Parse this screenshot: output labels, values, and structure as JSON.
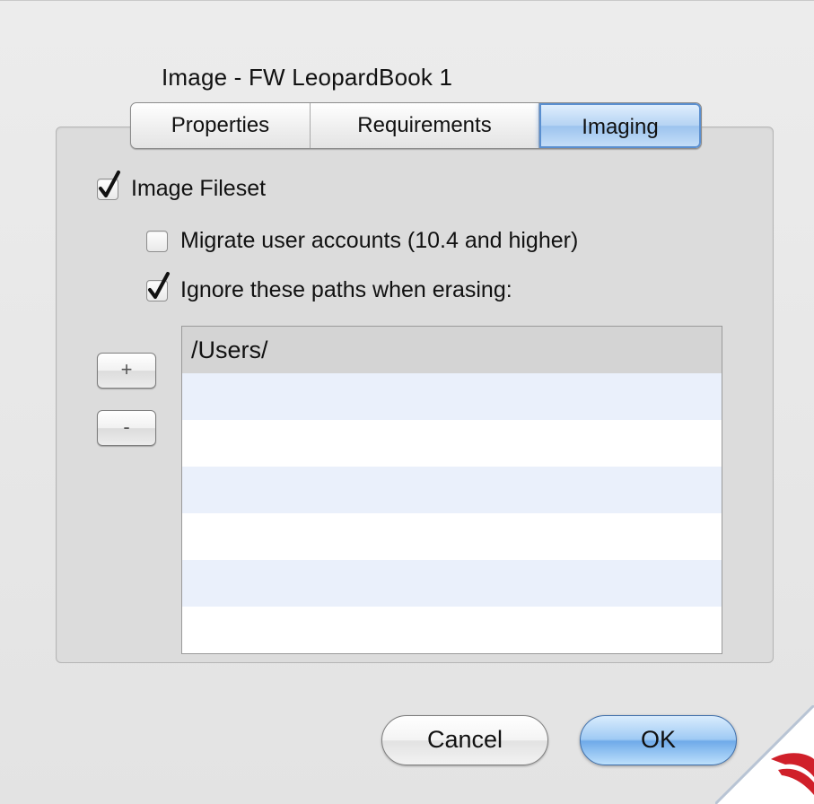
{
  "dialog": {
    "title": "Image - FW LeopardBook 1"
  },
  "tabs": [
    {
      "label": "Properties",
      "active": false
    },
    {
      "label": "Requirements",
      "active": false
    },
    {
      "label": "Imaging",
      "active": true
    }
  ],
  "imaging": {
    "image_fileset": {
      "label": "Image Fileset",
      "checked": true
    },
    "migrate_accounts": {
      "label": "Migrate user accounts (10.4 and higher)",
      "checked": false
    },
    "ignore_paths": {
      "label": "Ignore these paths when erasing:",
      "checked": true
    },
    "add_label": "+",
    "remove_label": "-",
    "paths": [
      "/Users/"
    ]
  },
  "buttons": {
    "cancel": "Cancel",
    "ok": "OK"
  },
  "colors": {
    "accent": "#6faae9",
    "corner_logo": "#d0202a"
  }
}
